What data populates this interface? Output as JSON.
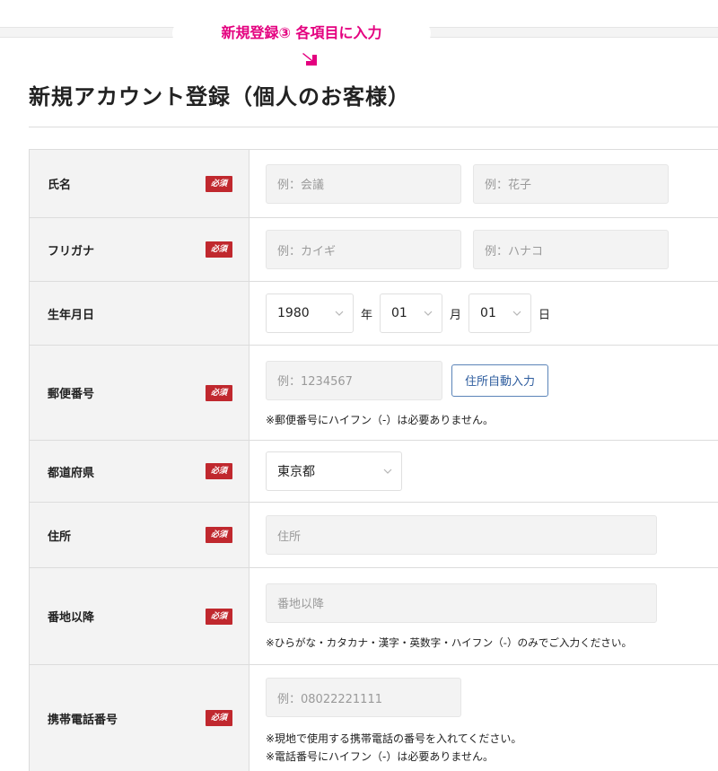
{
  "banner": {
    "text": "新規登録③ 各項目に入力"
  },
  "page": {
    "title": "新規アカウント登録（個人のお客様）"
  },
  "required_label": "必須",
  "colors": {
    "accent": "#e4007f",
    "required": "#c0282e",
    "link": "#2d5c9e"
  },
  "form": {
    "name": {
      "label": "氏名",
      "last_placeholder": "例：会議",
      "first_placeholder": "例：花子"
    },
    "furigana": {
      "label": "フリガナ",
      "last_placeholder": "例：カイギ",
      "first_placeholder": "例：ハナコ"
    },
    "birthdate": {
      "label": "生年月日",
      "year": "1980",
      "year_unit": "年",
      "month": "01",
      "month_unit": "月",
      "day": "01",
      "day_unit": "日"
    },
    "postal": {
      "label": "郵便番号",
      "placeholder": "例：1234567",
      "auto_button": "住所自動入力",
      "note": "※郵便番号にハイフン（-）は必要ありません。"
    },
    "prefecture": {
      "label": "都道府県",
      "value": "東京都"
    },
    "address": {
      "label": "住所",
      "placeholder": "住所"
    },
    "address2": {
      "label": "番地以降",
      "placeholder": "番地以降",
      "note": "※ひらがな・カタカナ・漢字・英数字・ハイフン（-）のみでご入力ください。"
    },
    "mobile": {
      "label": "携帯電話番号",
      "placeholder": "例：08022221111",
      "note1": "※現地で使用する携帯電話の番号を入れてください。",
      "note2": "※電話番号にハイフン（-）は必要ありません。"
    }
  }
}
